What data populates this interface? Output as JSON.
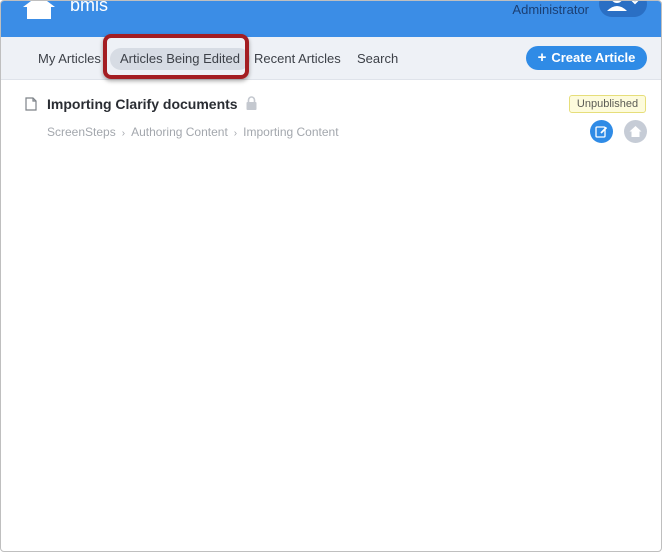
{
  "header": {
    "site_name": "bmis",
    "user_role": "Administrator"
  },
  "nav": {
    "tabs": [
      {
        "label": "My Articles"
      },
      {
        "label": "Articles Being Edited"
      },
      {
        "label": "Recent Articles"
      },
      {
        "label": "Search"
      }
    ],
    "active_tab": "Articles Being Edited",
    "create_label": "Create Article"
  },
  "article": {
    "title": "Importing Clarify documents",
    "status": "Unpublished",
    "breadcrumb": [
      "ScreenSteps",
      "Authoring Content",
      "Importing Content"
    ]
  },
  "colors": {
    "header_bg": "#3b8de6",
    "accent": "#2f8be6",
    "highlight_border": "#a31d22",
    "badge_bg": "#fdfbdc"
  },
  "icons": {
    "home": "home-icon",
    "user": "user-icon",
    "document": "document-icon",
    "lock": "lock-icon",
    "edit": "edit-icon",
    "home_small": "home-small-icon"
  }
}
